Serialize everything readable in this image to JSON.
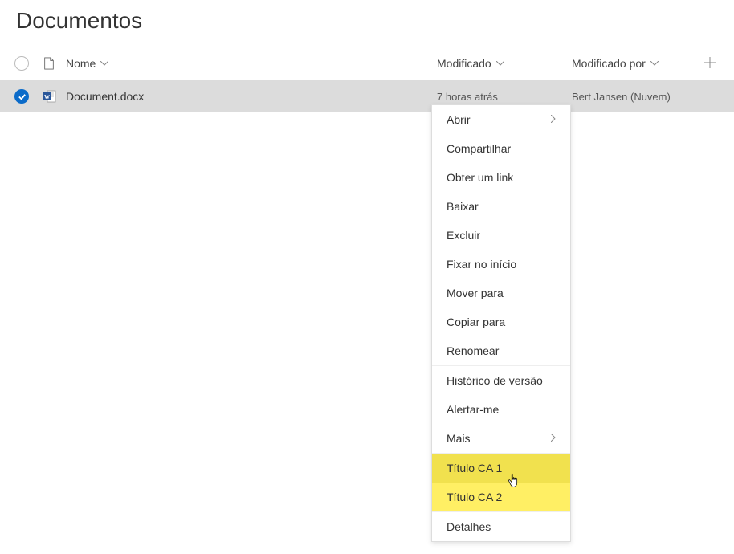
{
  "page": {
    "title": "Documentos"
  },
  "columns": {
    "name": "Nome",
    "modified": "Modificado",
    "modifiedBy": "Modificado por"
  },
  "rows": [
    {
      "name": "Document.docx",
      "modified": "7 horas atrás",
      "modifiedBy": "Bert Jansen (Nuvem)"
    }
  ],
  "menu": {
    "open": "Abrir",
    "share": "Compartilhar",
    "getLink": "Obter um link",
    "download": "Baixar",
    "delete": "Excluir",
    "pin": "Fixar no início",
    "moveTo": "Mover para",
    "copyTo": "Copiar para",
    "rename": "Renomear",
    "history": "Histórico de versão",
    "alert": "Alertar-me",
    "more": "Mais",
    "ca1": "Título CA 1",
    "ca2": "Título CA 2",
    "details": "Detalhes"
  }
}
